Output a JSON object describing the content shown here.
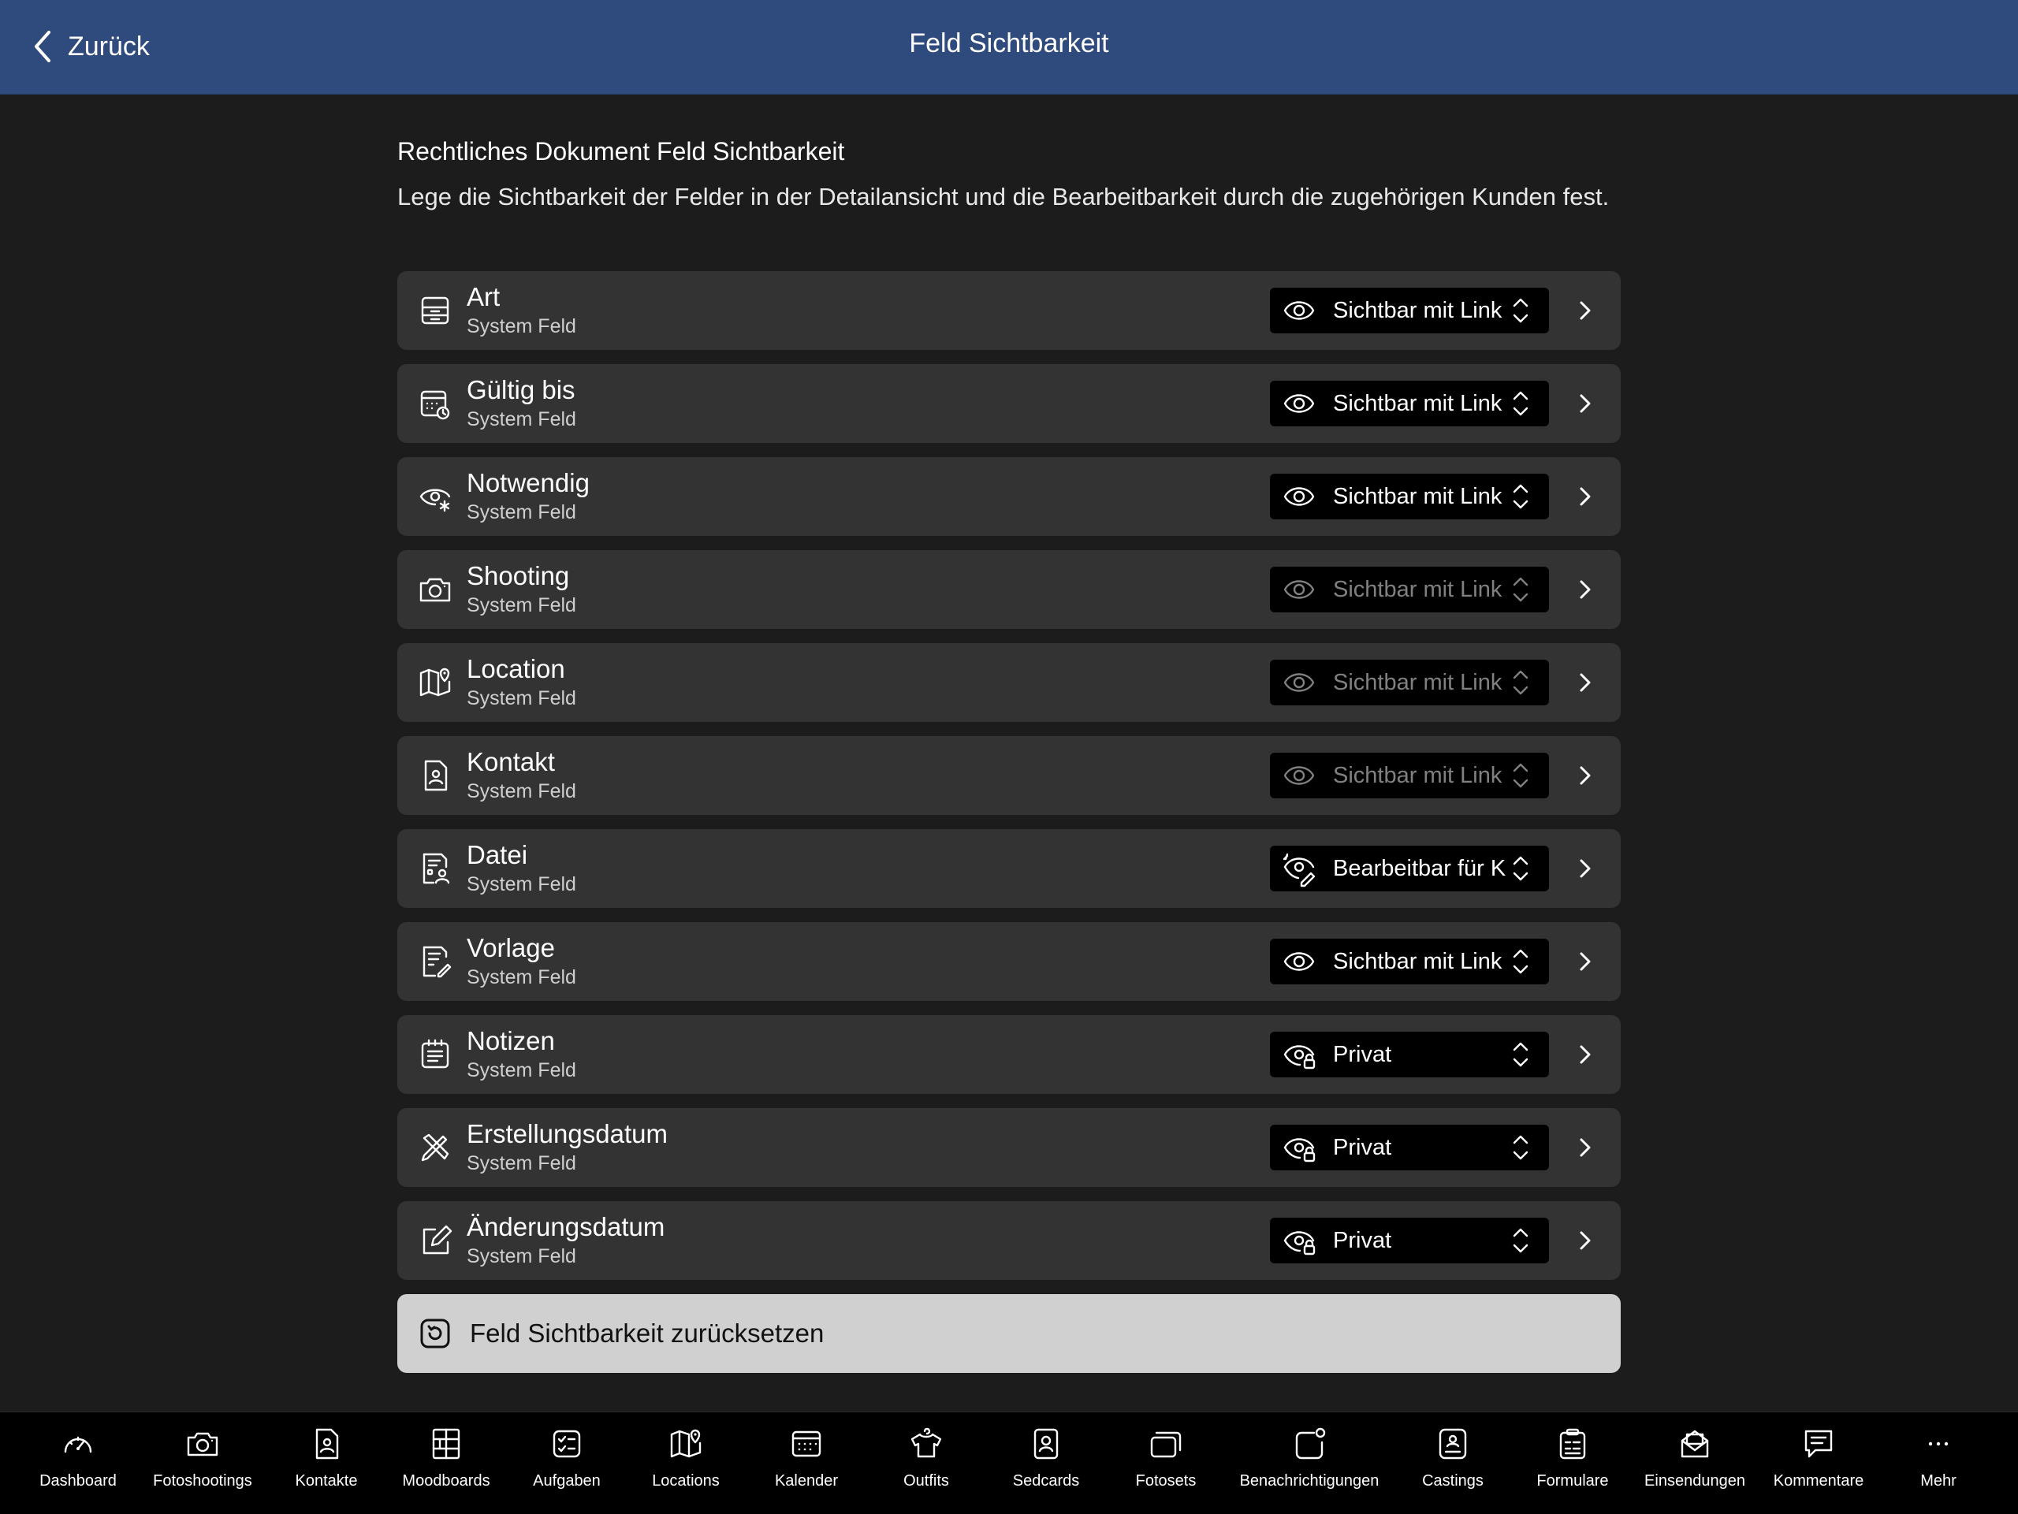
{
  "header": {
    "back_label": "Zurück",
    "title": "Feld Sichtbarkeit"
  },
  "section": {
    "title": "Rechtliches Dokument Feld Sichtbarkeit",
    "description": "Lege die Sichtbarkeit der Felder in der Detailansicht und die Bearbeitbarkeit durch die zugehörigen Kunden fest."
  },
  "fields": [
    {
      "name": "Art",
      "sub": "System Feld",
      "icon": "archive-box-icon",
      "visibility": "Sichtbar mit Link",
      "visibility_icon": "eye-icon",
      "enabled": true
    },
    {
      "name": "Gültig bis",
      "sub": "System Feld",
      "icon": "calendar-clock-icon",
      "visibility": "Sichtbar mit Link",
      "visibility_icon": "eye-icon",
      "enabled": true
    },
    {
      "name": "Notwendig",
      "sub": "System Feld",
      "icon": "eye-asterisk-icon",
      "visibility": "Sichtbar mit Link",
      "visibility_icon": "eye-icon",
      "enabled": true
    },
    {
      "name": "Shooting",
      "sub": "System Feld",
      "icon": "camera-icon",
      "visibility": "Sichtbar mit Link",
      "visibility_icon": "eye-icon",
      "enabled": false
    },
    {
      "name": "Location",
      "sub": "System Feld",
      "icon": "map-pin-icon",
      "visibility": "Sichtbar mit Link",
      "visibility_icon": "eye-icon",
      "enabled": false
    },
    {
      "name": "Kontakt",
      "sub": "System Feld",
      "icon": "contact-file-icon",
      "visibility": "Sichtbar mit Link",
      "visibility_icon": "eye-icon",
      "enabled": false
    },
    {
      "name": "Datei",
      "sub": "System Feld",
      "icon": "document-user-icon",
      "visibility": "Bearbeitbar für K",
      "visibility_icon": "eye-edit-icon",
      "enabled": true
    },
    {
      "name": "Vorlage",
      "sub": "System Feld",
      "icon": "document-edit-icon",
      "visibility": "Sichtbar mit Link",
      "visibility_icon": "eye-icon",
      "enabled": true
    },
    {
      "name": "Notizen",
      "sub": "System Feld",
      "icon": "notes-icon",
      "visibility": "Privat",
      "visibility_icon": "eye-lock-icon",
      "enabled": true
    },
    {
      "name": "Erstellungsdatum",
      "sub": "System Feld",
      "icon": "pencil-ruler-icon",
      "visibility": "Privat",
      "visibility_icon": "eye-lock-icon",
      "enabled": true
    },
    {
      "name": "Änderungsdatum",
      "sub": "System Feld",
      "icon": "edit-square-icon",
      "visibility": "Privat",
      "visibility_icon": "eye-lock-icon",
      "enabled": true
    }
  ],
  "reset_label": "Feld Sichtbarkeit zurücksetzen",
  "tabs": [
    {
      "label": "Dashboard",
      "icon": "speedometer-icon"
    },
    {
      "label": "Fotoshootings",
      "icon": "camera-icon"
    },
    {
      "label": "Kontakte",
      "icon": "contact-file-icon"
    },
    {
      "label": "Moodboards",
      "icon": "moodboard-grid-icon"
    },
    {
      "label": "Aufgaben",
      "icon": "checklist-icon"
    },
    {
      "label": "Locations",
      "icon": "map-pin-icon"
    },
    {
      "label": "Kalender",
      "icon": "calendar-icon"
    },
    {
      "label": "Outfits",
      "icon": "hanger-shirt-icon"
    },
    {
      "label": "Sedcards",
      "icon": "portrait-card-icon"
    },
    {
      "label": "Fotosets",
      "icon": "photo-stack-icon"
    },
    {
      "label": "Benachrichtigungen",
      "icon": "notification-badge-icon"
    },
    {
      "label": "Castings",
      "icon": "casting-card-icon"
    },
    {
      "label": "Formulare",
      "icon": "clipboard-form-icon"
    },
    {
      "label": "Einsendungen",
      "icon": "envelope-stack-icon"
    },
    {
      "label": "Kommentare",
      "icon": "comment-icon"
    },
    {
      "label": "Mehr",
      "icon": "more-dots-icon"
    }
  ]
}
